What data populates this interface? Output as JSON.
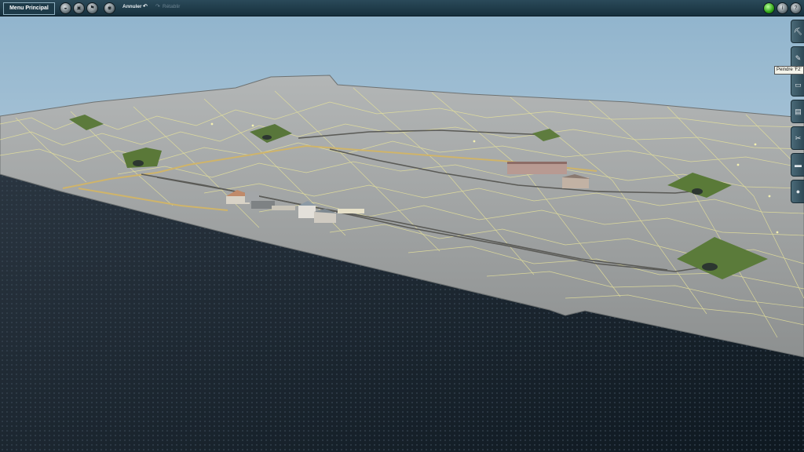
{
  "toolbar": {
    "main_menu_label": "Menu Principal",
    "undo_label": "Annuler",
    "redo_label": "Rétablir"
  },
  "sidebar": {
    "tooltip": "Peindre 'F2'"
  },
  "colors": {
    "sky": "#a9c3d6",
    "terrain": "#9a9c9a",
    "grid": "#e9e48a",
    "cliff": "#1c2630",
    "toolbar": "#1f3d4b"
  }
}
